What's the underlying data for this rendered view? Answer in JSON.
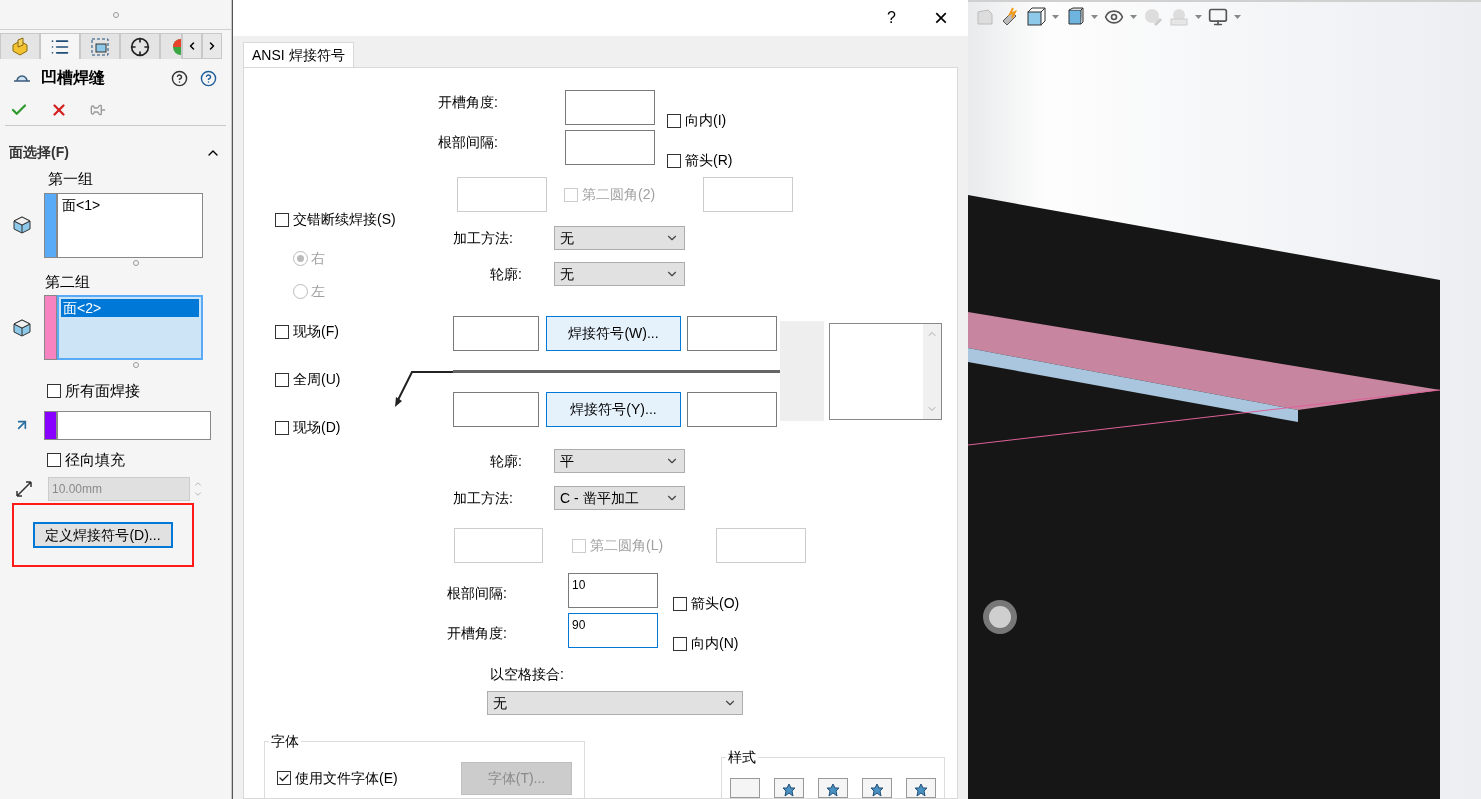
{
  "property_manager": {
    "tabs": [
      {
        "selected": false
      },
      {
        "selected": true
      },
      {
        "selected": false
      },
      {
        "selected": false
      },
      {
        "selected": false
      }
    ],
    "title": "凹槽焊缝",
    "section": {
      "title": "面选择(F)",
      "expanded": true
    },
    "groups": [
      {
        "label": "第一组",
        "color": "#5aabf7",
        "items": [
          {
            "text": "面<1>",
            "selected": false
          }
        ]
      },
      {
        "label": "第二组",
        "color": "#f784c0",
        "items": [
          {
            "text": "面<2>",
            "selected": true
          }
        ]
      }
    ],
    "all_faces": {
      "label": "所有面焊接",
      "checked": false
    },
    "radial_fill": {
      "label": "径向填充",
      "checked": false
    },
    "thickness": {
      "value": "10.00mm",
      "disabled": true
    },
    "define_button": "定义焊接符号(D)..."
  },
  "dialog": {
    "help": "?",
    "close": "×",
    "tabs": [
      {
        "label": "ANSI 焊接符号",
        "selected": true
      }
    ],
    "arrow_side": {
      "angle_label": "开槽角度:",
      "inward": {
        "label": "向内(I)",
        "checked": false
      },
      "gap_label": "根部间隔:",
      "arrow": {
        "label": "箭头(R)",
        "checked": false
      },
      "second_fillet": {
        "label": "第二圆角(2)",
        "checked": false,
        "disabled": true
      },
      "finish": {
        "label": "加工方法:",
        "value": "无"
      },
      "contour": {
        "label": "轮廓:",
        "value": "无"
      }
    },
    "staggered": {
      "label": "交错断续焊接(S)",
      "checked": false
    },
    "sides": [
      {
        "label": "右",
        "selected": true,
        "disabled": true
      },
      {
        "label": "左",
        "selected": false,
        "disabled": true
      }
    ],
    "options": [
      {
        "label": "现场(F)",
        "checked": false
      },
      {
        "label": "全周(U)",
        "checked": false
      },
      {
        "label": "现场(D)",
        "checked": false
      }
    ],
    "symbol_buttons": [
      "焊接符号(W)...",
      "焊接符号(Y)..."
    ],
    "other_side": {
      "contour": {
        "label": "轮廓:",
        "value": "平"
      },
      "finish": {
        "label": "加工方法:",
        "value": "C - 凿平加工"
      },
      "second_fillet": {
        "label": "第二圆角(L)",
        "checked": false,
        "disabled": true
      },
      "gap": {
        "label": "根部间隔:",
        "value": "10"
      },
      "arrow": {
        "label": "箭头(O)",
        "checked": false
      },
      "angle": {
        "label": "开槽角度:",
        "value": "90",
        "focused": true
      },
      "inward": {
        "label": "向内(N)",
        "checked": false
      }
    },
    "joint": {
      "label": "以空格接合:",
      "value": "无"
    },
    "font": {
      "title": "字体",
      "use_document_font": {
        "label": "使用文件字体(E)",
        "checked": true
      },
      "font_button": {
        "label": "字体(T)...",
        "disabled": true
      }
    },
    "style": {
      "title": "样式"
    }
  }
}
